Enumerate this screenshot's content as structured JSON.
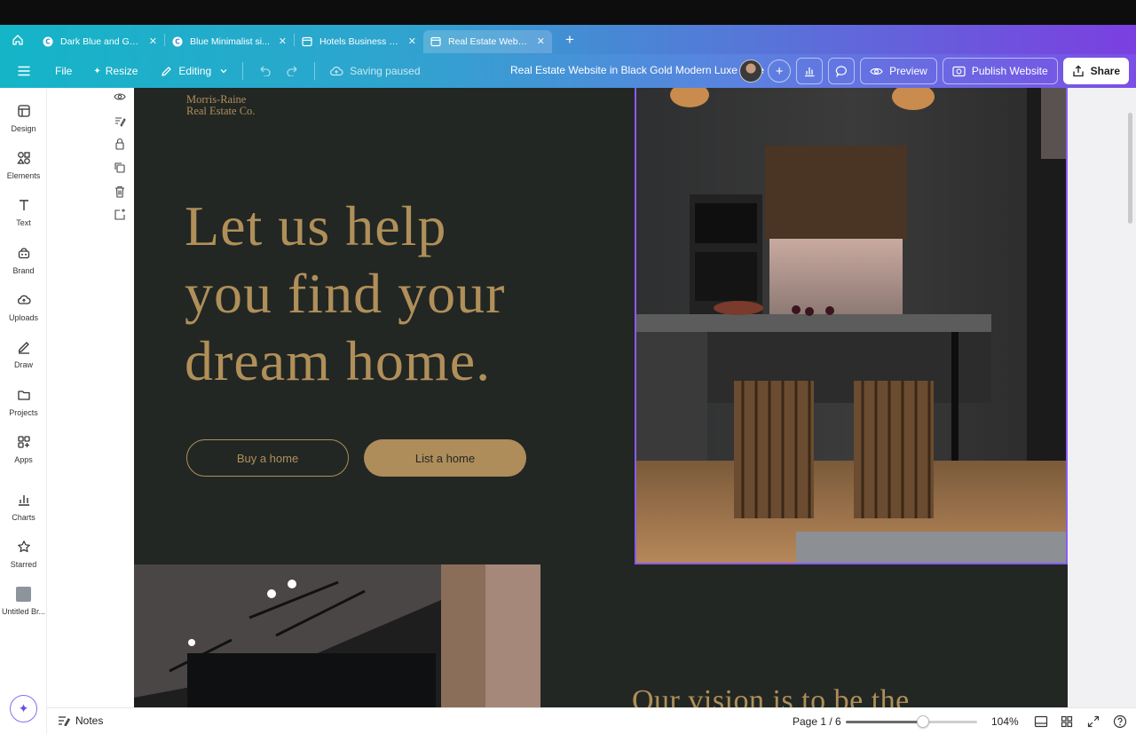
{
  "tabs": [
    {
      "title": "Dark Blue and Gold...",
      "icon": "canva-logo-icon",
      "active": false
    },
    {
      "title": "Blue Minimalist si...",
      "icon": "canva-logo-icon",
      "active": false
    },
    {
      "title": "Hotels Business W...",
      "icon": "website-icon",
      "active": false
    },
    {
      "title": "Real Estate Websit...",
      "icon": "website-icon",
      "active": true
    }
  ],
  "toolbar": {
    "file_label": "File",
    "resize_label": "Resize",
    "editing_label": "Editing",
    "saving_label": "Saving paused",
    "doc_title": "Real Estate Website in Black Gold Modern Luxe Style",
    "preview_label": "Preview",
    "publish_label": "Publish Website",
    "share_label": "Share"
  },
  "sidebar": {
    "items": [
      {
        "label": "Design",
        "icon": "design-icon"
      },
      {
        "label": "Elements",
        "icon": "elements-icon"
      },
      {
        "label": "Text",
        "icon": "text-icon"
      },
      {
        "label": "Brand",
        "icon": "brand-icon"
      },
      {
        "label": "Uploads",
        "icon": "uploads-icon"
      },
      {
        "label": "Draw",
        "icon": "draw-icon"
      },
      {
        "label": "Projects",
        "icon": "projects-icon"
      },
      {
        "label": "Apps",
        "icon": "apps-icon"
      },
      {
        "label": "Charts",
        "icon": "charts-icon"
      },
      {
        "label": "Starred",
        "icon": "star-icon"
      },
      {
        "label": "Untitled Br...",
        "icon": "brand-kit-thumbnail"
      }
    ]
  },
  "rail": {
    "icons": [
      "eye-icon",
      "notes-edit-icon",
      "lock-icon",
      "duplicate-icon",
      "trash-icon",
      "add-page-icon"
    ]
  },
  "canvas": {
    "brand_line1": "Morris-Raine",
    "brand_line2": "Real Estate Co.",
    "headline_line1": "Let us help",
    "headline_line2": "you find your",
    "headline_line3": "dream home.",
    "buy_label": "Buy a home",
    "list_label": "List a home",
    "vision_text": "Our vision is to be the"
  },
  "bottombar": {
    "notes_label": "Notes",
    "page_indicator": "Page 1 / 6",
    "zoom_label": "104%",
    "zoom_fraction": 0.59
  },
  "colors": {
    "gold": "#b08f59",
    "dark_bg": "#222724",
    "selection": "#8a5cf3"
  }
}
